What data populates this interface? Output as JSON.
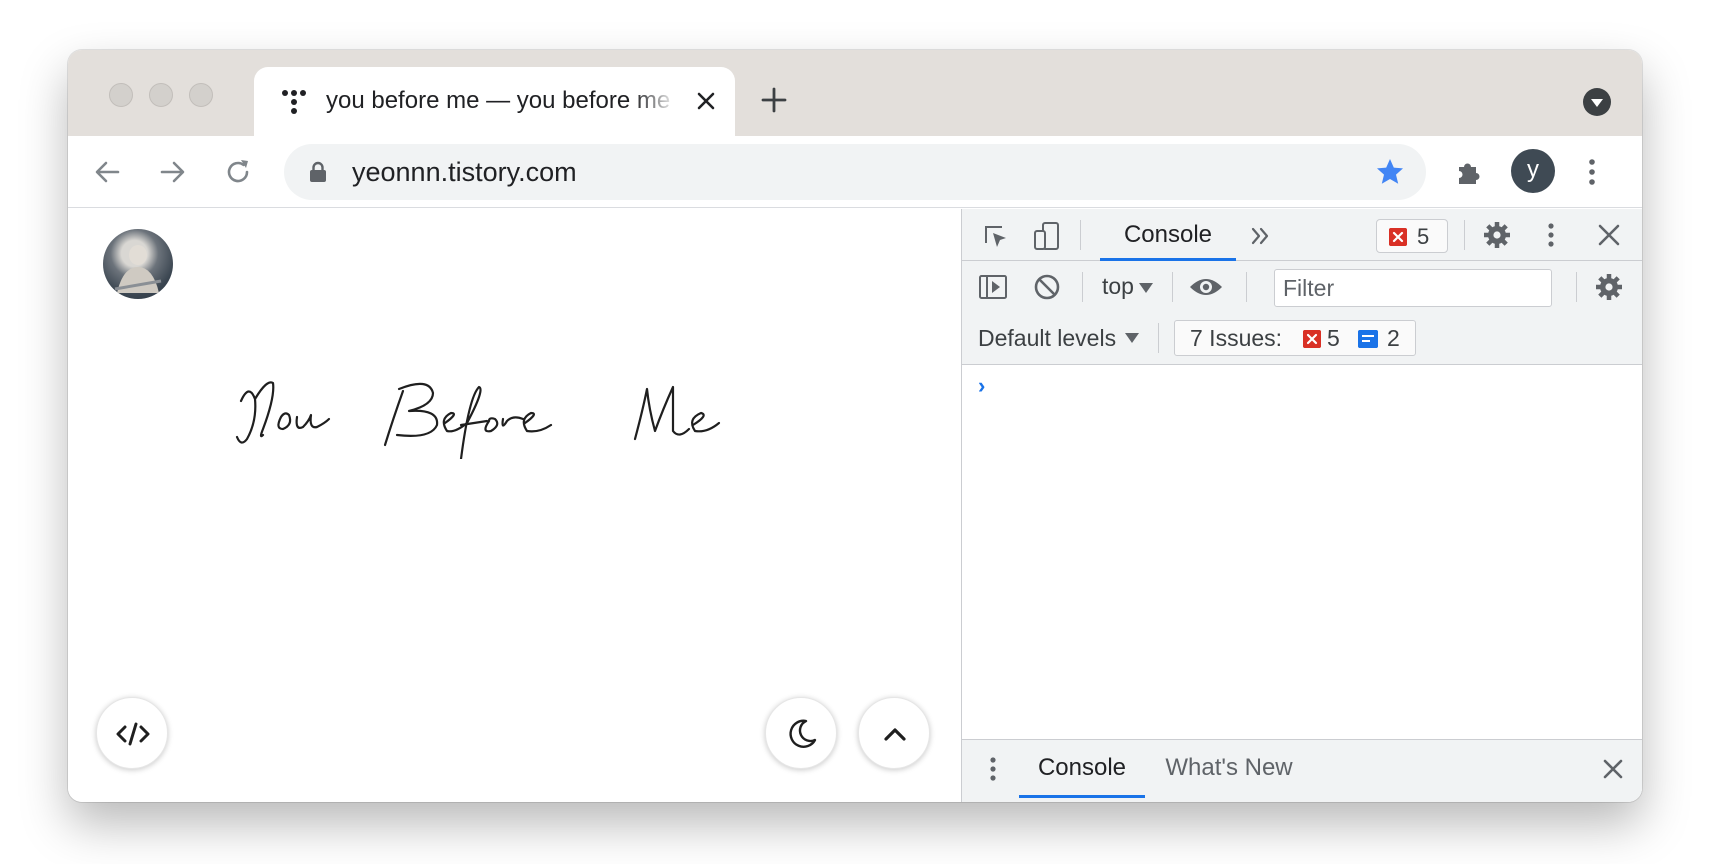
{
  "browser": {
    "tab": {
      "title": "you before me — you before me",
      "favicon": "tistory-dots-icon"
    },
    "address": {
      "url": "yeonnn.tistory.com",
      "secure": true
    },
    "profile_initial": "y",
    "bookmark_star_color": "#4285f4"
  },
  "page": {
    "signature_text": "You Before Me",
    "buttons": {
      "code": "code-icon",
      "dark_mode": "moon-icon",
      "scroll_top": "chevron-up-icon"
    }
  },
  "devtools": {
    "main_tab": "Console",
    "error_count": "5",
    "context": "top",
    "filter_placeholder": "Filter",
    "levels_label": "Default levels",
    "issues": {
      "label": "7 Issues:",
      "errors": "5",
      "messages": "2"
    },
    "prompt_symbol": "›",
    "drawer_tabs": [
      "Console",
      "What's New"
    ],
    "colors": {
      "accent": "#1a73e8",
      "error": "#d93025"
    }
  }
}
